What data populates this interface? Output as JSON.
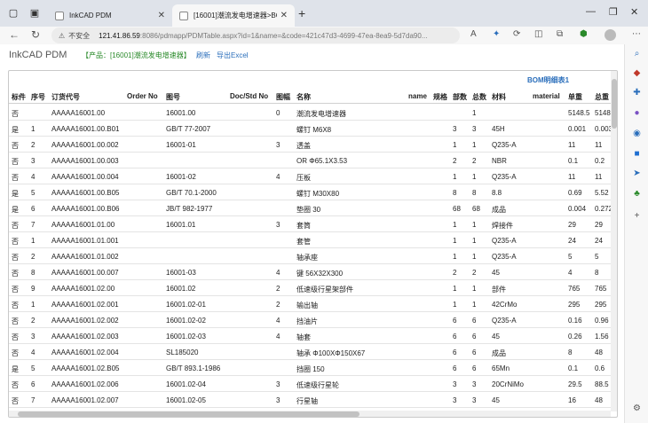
{
  "browser": {
    "tabs": [
      {
        "title": "InkCAD PDM",
        "active": false
      },
      {
        "title": "[16001]潮流发电增速器>BOM明细",
        "active": true
      }
    ],
    "address": {
      "security": "不安全",
      "host": "121.41.86.59",
      "path": ":8086/pdmapp/PDMTable.aspx?id=1&name=&code=421c47d3-4699-47ea-8ea9-5d7da90..."
    }
  },
  "toolbar": {
    "app_title": "InkCAD PDM",
    "product": "【产品：[16001]潮流发电增速器】",
    "refresh": "刷新",
    "export": "导出Excel"
  },
  "table": {
    "title": "BOM明细表1",
    "columns": [
      "标件",
      "序号",
      "订货代号",
      "Order No",
      "图号",
      "Doc/Std No",
      "图幅",
      "名称",
      "name",
      "规格",
      "部数",
      "总数",
      "材料",
      "material",
      "单重",
      "总重"
    ],
    "rows": [
      [
        "否",
        "",
        "AAAAA16001.00",
        "16001.00",
        "0",
        "潮流发电增速器",
        "",
        "1",
        "",
        "5148.5",
        "5148.5"
      ],
      [
        "是",
        "1",
        "AAAAA16001.00.B01",
        "GB/T 77-2007",
        "",
        "螺钉 M6X8",
        "3",
        "3",
        "45H",
        "0.001",
        "0.003"
      ],
      [
        "否",
        "2",
        "AAAAA16001.00.002",
        "16001-01",
        "3",
        "透盖",
        "1",
        "1",
        "Q235-A",
        "11",
        "11"
      ],
      [
        "否",
        "3",
        "AAAAA16001.00.003",
        "",
        "",
        "OR Φ65.1X3.53",
        "2",
        "2",
        "NBR",
        "0.1",
        "0.2"
      ],
      [
        "否",
        "4",
        "AAAAA16001.00.004",
        "16001-02",
        "4",
        "压板",
        "1",
        "1",
        "Q235-A",
        "11",
        "11"
      ],
      [
        "是",
        "5",
        "AAAAA16001.00.B05",
        "GB/T 70.1-2000",
        "",
        "螺钉 M30X80",
        "8",
        "8",
        "8.8",
        "0.69",
        "5.52"
      ],
      [
        "是",
        "6",
        "AAAAA16001.00.B06",
        "JB/T 982-1977",
        "",
        "垫圈 30",
        "68",
        "68",
        "成品",
        "0.004",
        "0.272"
      ],
      [
        "否",
        "7",
        "AAAAA16001.01.00",
        "16001.01",
        "3",
        "套筒",
        "1",
        "1",
        "焊接件",
        "29",
        "29"
      ],
      [
        "否",
        "1",
        "AAAAA16001.01.001",
        "",
        "",
        "套管",
        "1",
        "1",
        "Q235-A",
        "24",
        "24"
      ],
      [
        "否",
        "2",
        "AAAAA16001.01.002",
        "",
        "",
        "轴承座",
        "1",
        "1",
        "Q235-A",
        "5",
        "5"
      ],
      [
        "否",
        "8",
        "AAAAA16001.00.007",
        "16001-03",
        "4",
        "键 56X32X300",
        "2",
        "2",
        "45",
        "4",
        "8"
      ],
      [
        "否",
        "9",
        "AAAAA16001.02.00",
        "16001.02",
        "2",
        "低速级行星架部件",
        "1",
        "1",
        "部件",
        "765",
        "765"
      ],
      [
        "否",
        "1",
        "AAAAA16001.02.001",
        "16001.02-01",
        "2",
        "输出轴",
        "1",
        "1",
        "42CrMo",
        "295",
        "295"
      ],
      [
        "否",
        "2",
        "AAAAA16001.02.002",
        "16001.02-02",
        "4",
        "挡油片",
        "6",
        "6",
        "Q235-A",
        "0.16",
        "0.96"
      ],
      [
        "否",
        "3",
        "AAAAA16001.02.003",
        "16001.02-03",
        "4",
        "轴套",
        "6",
        "6",
        "45",
        "0.26",
        "1.56"
      ],
      [
        "否",
        "4",
        "AAAAA16001.02.004",
        "SL185020",
        "",
        "轴承 Φ100XΦ150X67",
        "6",
        "6",
        "成品",
        "8",
        "48"
      ],
      [
        "是",
        "5",
        "AAAAA16001.02.B05",
        "GB/T 893.1-1986",
        "",
        "挡圈 150",
        "6",
        "6",
        "65Mn",
        "0.1",
        "0.6"
      ],
      [
        "否",
        "6",
        "AAAAA16001.02.006",
        "16001.02-04",
        "3",
        "低速级行星轮",
        "3",
        "3",
        "20CrNiMo",
        "29.5",
        "88.5"
      ],
      [
        "否",
        "7",
        "AAAAA16001.02.007",
        "16001.02-05",
        "3",
        "行星轴",
        "3",
        "3",
        "45",
        "16",
        "48"
      ]
    ]
  }
}
